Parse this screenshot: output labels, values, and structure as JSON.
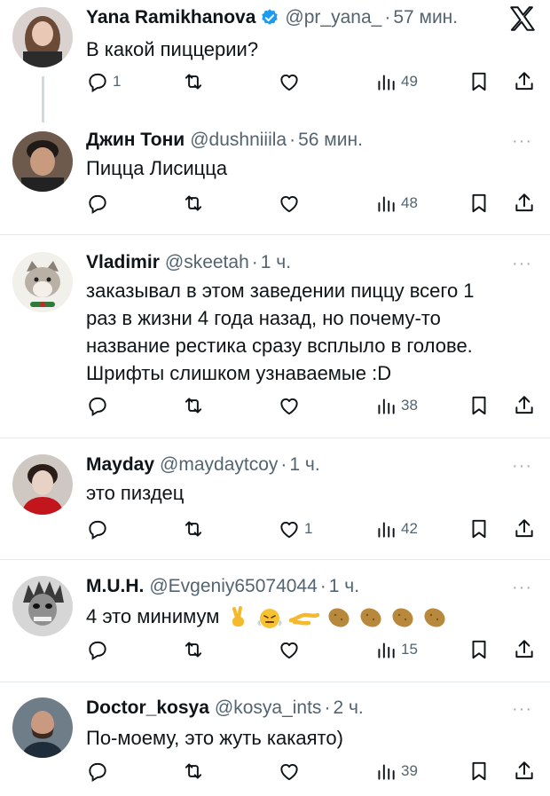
{
  "tweets": [
    {
      "name": "Yana Ramikhanova",
      "verified": true,
      "handle": "@pr_yana_",
      "time": "57 мин.",
      "text": [
        "В какой пиццерии?"
      ],
      "replies": "1",
      "views": "49",
      "avatar": "avatar-woman-long-hair"
    },
    {
      "name": "Джин Тони",
      "handle": "@dushniiila",
      "time": "56 мин.",
      "text": [
        "Пицца Лисицца"
      ],
      "views": "48",
      "avatar": "avatar-man-dark-hair"
    },
    {
      "name": "Vladimir",
      "handle": "@skeetah",
      "time": "1 ч.",
      "text": [
        "заказывал в этом заведении пиццу всего 1",
        "раз в жизни 4 года назад, но почему-то",
        "название рестика сразу всплыло в голове.",
        "Шрифты слишком узнаваемые :D"
      ],
      "views": "38",
      "avatar": "avatar-cat"
    },
    {
      "name": "Mayday",
      "handle": "@maydaytcoy",
      "time": "1 ч.",
      "text": [
        "это пиздец"
      ],
      "likes": "1",
      "views": "42",
      "avatar": "avatar-woman-red"
    },
    {
      "name": "M.U.H.",
      "handle": "@Evgeniy65074044",
      "time": "1 ч.",
      "text": [
        "4 это минимум"
      ],
      "emojis": [
        "victory-hand-emoji",
        "steaming-face-emoji",
        "pinched-hand-emoji",
        "potato-emoji",
        "potato-emoji",
        "potato-emoji",
        "potato-emoji"
      ],
      "views": "15",
      "avatar": "avatar-monochrome-face"
    },
    {
      "name": "Doctor_kosya",
      "handle": "@kosya_ints",
      "time": "2 ч.",
      "text": [
        "По-моему, это жуть какаято)"
      ],
      "views": "39",
      "avatar": "avatar-man-beard"
    }
  ],
  "separator": "·",
  "more_label": "···",
  "colors": {
    "text": "#0f1419",
    "muted": "#536471",
    "verified": "#1d9bf0",
    "divider": "#e6e9ec"
  }
}
